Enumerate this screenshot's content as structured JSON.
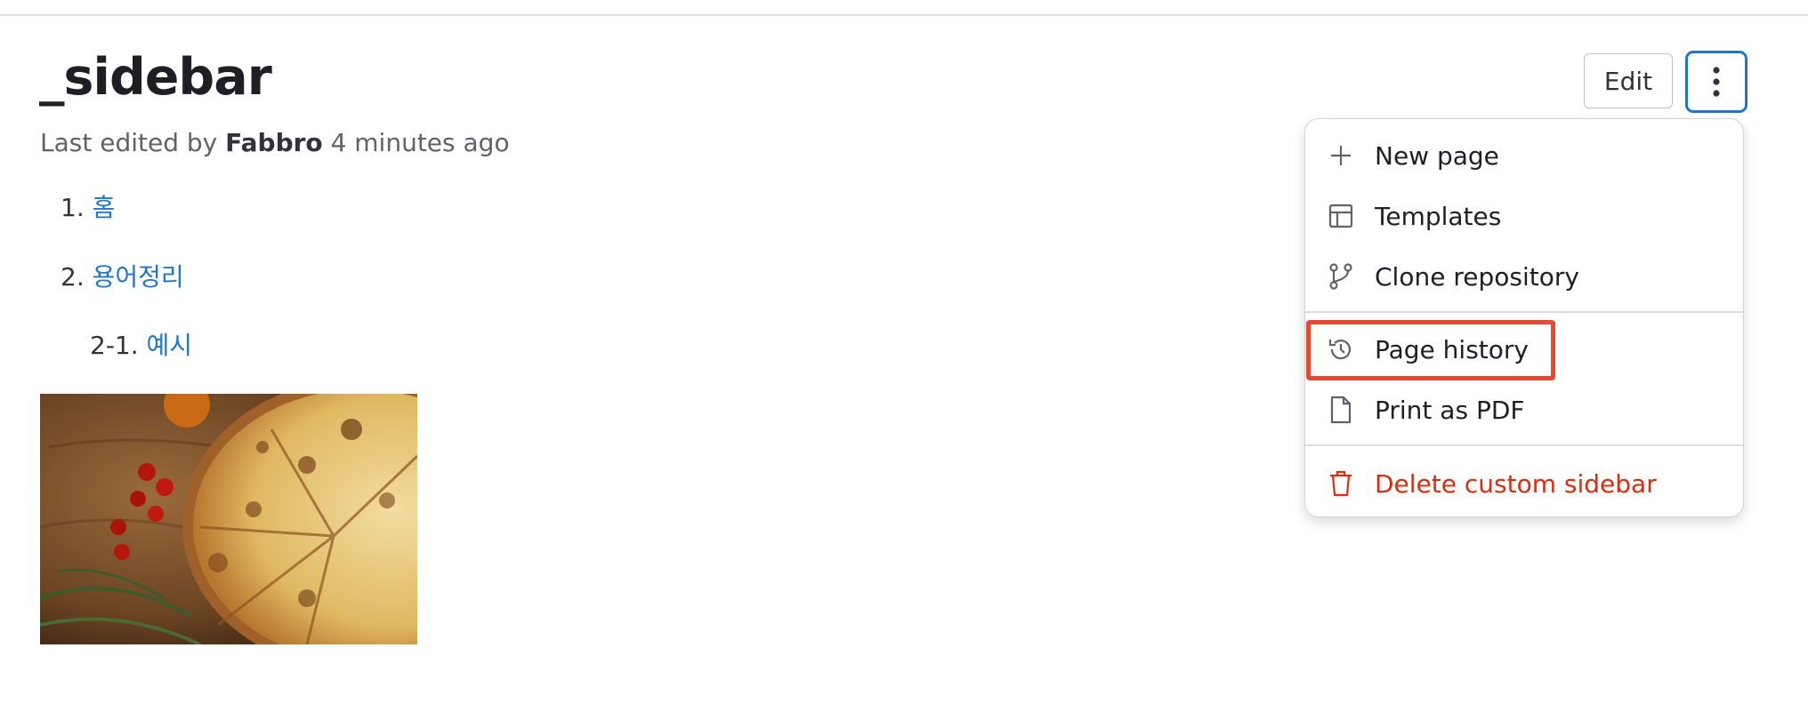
{
  "page": {
    "title": "_sidebar",
    "meta_prefix": "Last edited by",
    "meta_author": "Fabbro",
    "meta_time": "4 minutes ago"
  },
  "content": {
    "items": [
      {
        "number": "1.",
        "link": "홈"
      },
      {
        "number": "2.",
        "link": "용어정리"
      },
      {
        "number": "2-1.",
        "link": "예시"
      }
    ],
    "image_alt": "Pizza on a wooden board with cherry tomatoes and rosemary"
  },
  "toolbar": {
    "edit_label": "Edit",
    "more_icon": "ellipsis-vertical-icon"
  },
  "dropdown": {
    "items": [
      {
        "label": "New page",
        "icon": "plus-icon"
      },
      {
        "label": "Templates",
        "icon": "template-icon"
      },
      {
        "label": "Clone repository",
        "icon": "branch-icon"
      },
      {
        "label": "Page history",
        "icon": "history-icon"
      },
      {
        "label": "Print as PDF",
        "icon": "document-icon"
      },
      {
        "label": "Delete custom sidebar",
        "icon": "trash-icon"
      }
    ]
  },
  "colors": {
    "link": "#1f75cb",
    "danger": "#dd2b0e",
    "focus": "#1f75cb",
    "highlight": "#e8482f"
  }
}
